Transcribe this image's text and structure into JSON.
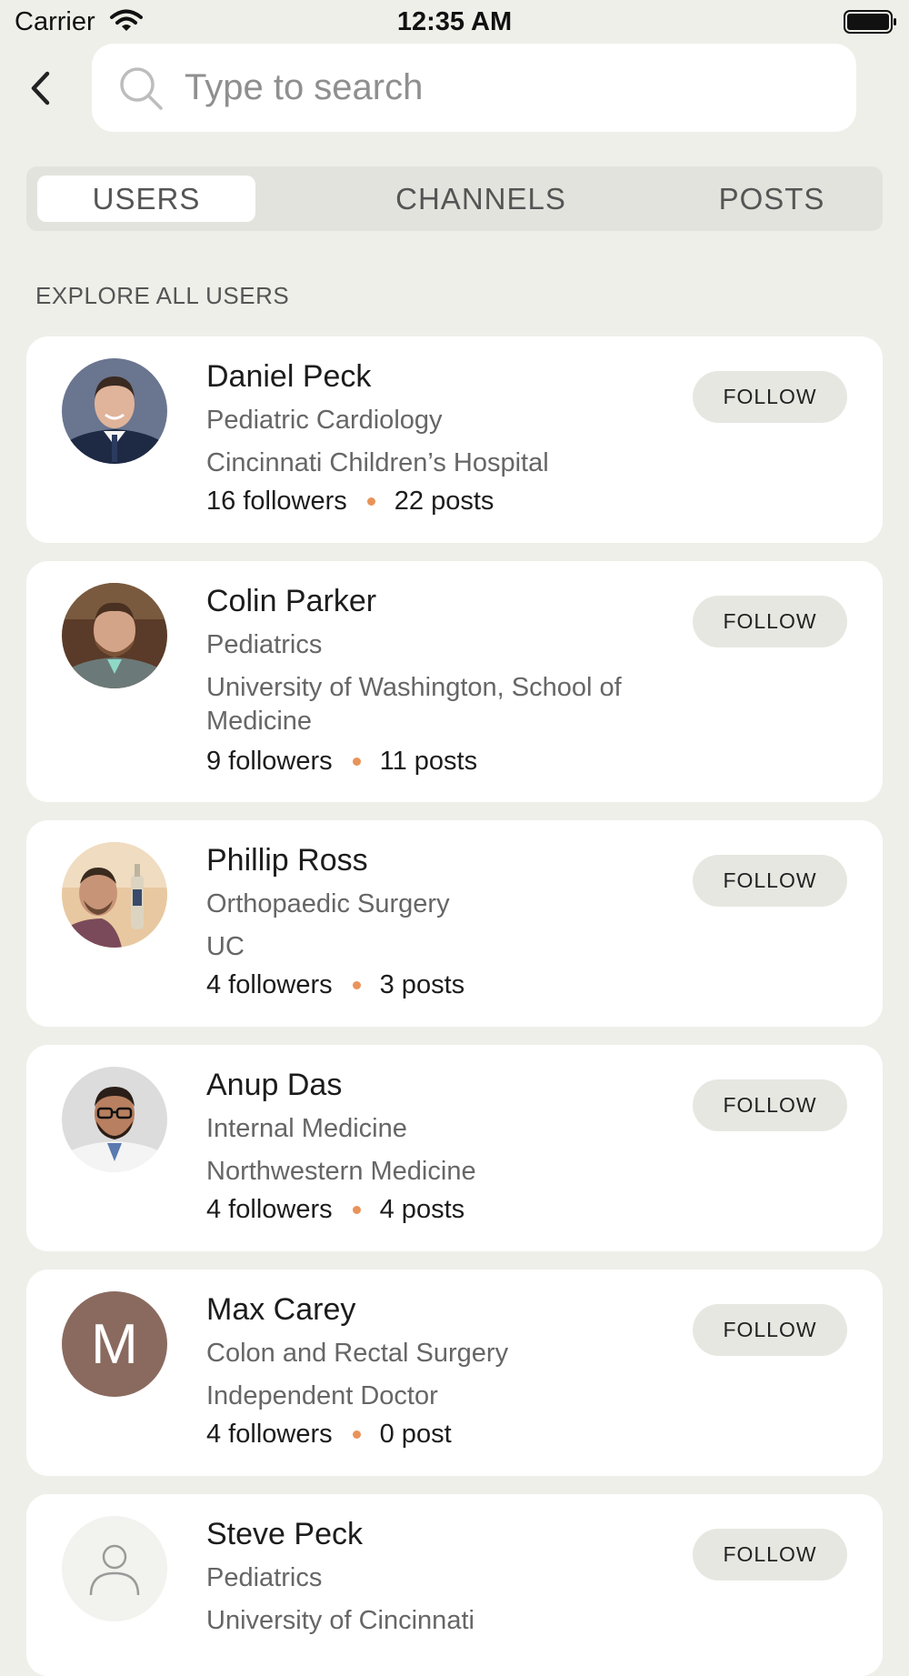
{
  "status_bar": {
    "carrier": "Carrier",
    "time": "12:35 AM"
  },
  "search": {
    "placeholder": "Type to search",
    "value": ""
  },
  "tabs": [
    {
      "label": "USERS",
      "active": true
    },
    {
      "label": "CHANNELS",
      "active": false
    },
    {
      "label": "POSTS",
      "active": false
    }
  ],
  "section_title": "EXPLORE ALL USERS",
  "colors": {
    "background": "#efefea",
    "card": "#ffffff",
    "follow_button": "#e7e7e2",
    "stat_dot": "#e9935a",
    "initial_avatar": "#8a6a5f"
  },
  "users": [
    {
      "name": "Daniel Peck",
      "specialty": "Pediatric Cardiology",
      "organization": "Cincinnati Children’s Hospital",
      "followers": "16 followers",
      "posts": "22 posts",
      "follow_label": "FOLLOW",
      "avatar": "photo"
    },
    {
      "name": "Colin Parker",
      "specialty": "Pediatrics",
      "organization": "University of Washington, School of Medicine",
      "followers": "9 followers",
      "posts": "11 posts",
      "follow_label": "FOLLOW",
      "avatar": "photo"
    },
    {
      "name": "Phillip Ross",
      "specialty": "Orthopaedic Surgery",
      "organization": "UC",
      "followers": "4 followers",
      "posts": "3 posts",
      "follow_label": "FOLLOW",
      "avatar": "photo"
    },
    {
      "name": "Anup Das",
      "specialty": "Internal Medicine",
      "organization": "Northwestern Medicine",
      "followers": "4 followers",
      "posts": "4 posts",
      "follow_label": "FOLLOW",
      "avatar": "photo"
    },
    {
      "name": "Max Carey",
      "specialty": "Colon and Rectal Surgery",
      "organization": "Independent Doctor",
      "followers": "4 followers",
      "posts": "0 post",
      "follow_label": "FOLLOW",
      "avatar": "initial",
      "initial": "M"
    },
    {
      "name": "Steve Peck",
      "specialty": "Pediatrics",
      "organization": "University of Cincinnati",
      "followers": "",
      "posts": "",
      "follow_label": "FOLLOW",
      "avatar": "placeholder-icon"
    }
  ]
}
